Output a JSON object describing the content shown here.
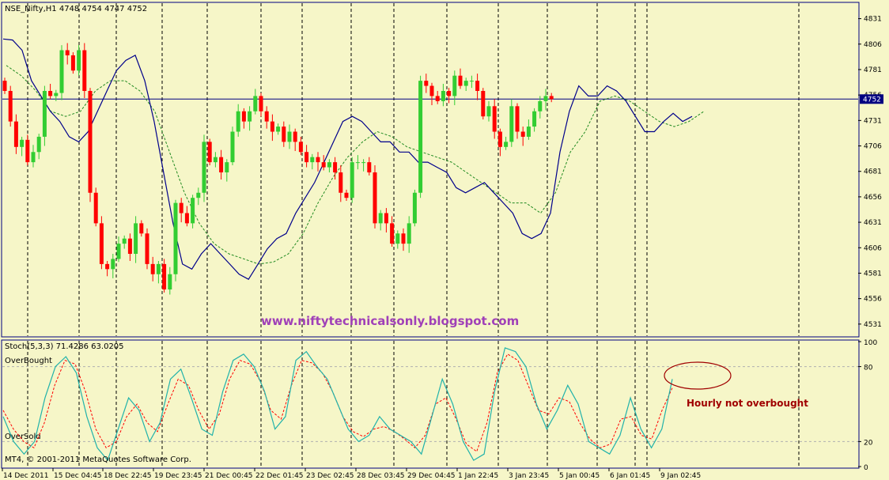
{
  "colors": {
    "background": "#f6f6c8",
    "frame": "#000080",
    "bull": "#32cd32",
    "bear": "#ff0000",
    "ma_fast": "#00008b",
    "ma_slow": "#228b22",
    "stoch_main": "#20b2aa",
    "stoch_signal": "#ff0000",
    "watermark": "#a040b8",
    "annotation": "#a00000",
    "current_price_box": "#000080"
  },
  "chart_data": [
    {
      "type": "candlestick",
      "title": "NSE_Nifty,H1  4748 4754 4747 4752",
      "ylim": [
        4520,
        4840
      ],
      "y_ticks": [
        "4831",
        "4806",
        "4781",
        "4756",
        "4731",
        "4706",
        "4681",
        "4656",
        "4631",
        "4606",
        "4581",
        "4556",
        "4531"
      ],
      "current_price": "4752",
      "x_labels": [
        "14 Dec 2011",
        "15 Dec 04:45",
        "18 Dec 22:45",
        "19 Dec 23:45",
        "21 Dec 00:45",
        "22 Dec 01:45",
        "23 Dec 02:45",
        "28 Dec 03:45",
        "29 Dec 04:45",
        "1 Jan 22:45",
        "3 Jan 23:45",
        "5 Jan 00:45",
        "6 Jan 01:45",
        "9 Jan 02:45"
      ],
      "watermark": "www.niftytechnicalsonly.blogspot.com",
      "candles_close": [
        4760,
        4730,
        4705,
        4712,
        4690,
        4700,
        4715,
        4760,
        4755,
        4758,
        4800,
        4795,
        4780,
        4800,
        4760,
        4660,
        4630,
        4590,
        4585,
        4595,
        4610,
        4615,
        4600,
        4630,
        4620,
        4590,
        4580,
        4590,
        4565,
        4580,
        4650,
        4640,
        4630,
        4655,
        4660,
        4710,
        4690,
        4695,
        4680,
        4690,
        4720,
        4740,
        4730,
        4740,
        4755,
        4740,
        4730,
        4720,
        4725,
        4710,
        4720,
        4710,
        4700,
        4690,
        4695,
        4690,
        4685,
        4690,
        4680,
        4660,
        4655,
        4690,
        4690,
        4690,
        4680,
        4630,
        4640,
        4630,
        4610,
        4620,
        4610,
        4630,
        4660,
        4770,
        4765,
        4755,
        4750,
        4760,
        4755,
        4775,
        4765,
        4770,
        4770,
        4760,
        4735,
        4745,
        4720,
        4705,
        4710,
        4745,
        4720,
        4715,
        4725,
        4740,
        4750,
        4755,
        4752
      ],
      "fast_ma": [
        4811,
        4810,
        4800,
        4770,
        4755,
        4740,
        4730,
        4715,
        4710,
        4720,
        4740,
        4760,
        4780,
        4790,
        4795,
        4770,
        4730,
        4680,
        4630,
        4590,
        4585,
        4600,
        4610,
        4600,
        4590,
        4580,
        4575,
        4590,
        4605,
        4615,
        4620,
        4640,
        4655,
        4670,
        4690,
        4710,
        4730,
        4735,
        4730,
        4720,
        4710,
        4710,
        4700,
        4700,
        4690,
        4690,
        4685,
        4680,
        4665,
        4660,
        4665,
        4670,
        4660,
        4650,
        4640,
        4620,
        4615,
        4620,
        4640,
        4700,
        4740,
        4765,
        4755,
        4755,
        4765,
        4760,
        4750,
        4735,
        4720,
        4720,
        4730,
        4738,
        4730,
        4735
      ],
      "slow_ma": [
        4785,
        4775,
        4760,
        4740,
        4735,
        4740,
        4760,
        4770,
        4770,
        4760,
        4740,
        4700,
        4660,
        4630,
        4610,
        4600,
        4595,
        4590,
        4592,
        4600,
        4620,
        4650,
        4675,
        4695,
        4710,
        4720,
        4715,
        4705,
        4700,
        4695,
        4690,
        4680,
        4670,
        4660,
        4650,
        4650,
        4640,
        4660,
        4700,
        4720,
        4750,
        4755,
        4750,
        4740,
        4730,
        4725,
        4730,
        4740
      ]
    },
    {
      "type": "line",
      "title": "Stoch(5,3,3) 71.4286 63.0205",
      "ylim": [
        0,
        100
      ],
      "y_ticks": [
        "100",
        "80",
        "20",
        "0"
      ],
      "levels": {
        "overbought": 80,
        "oversold": 20
      },
      "overbought_label": "OverBought",
      "oversold_label": "OverSold",
      "annotation": "Hourly not overbought",
      "main": [
        40,
        20,
        10,
        20,
        55,
        80,
        88,
        75,
        40,
        15,
        5,
        30,
        55,
        45,
        20,
        35,
        70,
        78,
        55,
        30,
        25,
        60,
        85,
        90,
        80,
        60,
        30,
        40,
        85,
        92,
        80,
        70,
        50,
        30,
        20,
        25,
        40,
        30,
        25,
        20,
        10,
        40,
        70,
        50,
        20,
        5,
        10,
        60,
        95,
        92,
        80,
        50,
        30,
        45,
        65,
        50,
        20,
        15,
        10,
        25,
        55,
        30,
        15,
        30,
        70
      ],
      "signal": [
        45,
        30,
        20,
        15,
        35,
        65,
        85,
        82,
        60,
        30,
        15,
        20,
        40,
        50,
        35,
        28,
        50,
        70,
        65,
        45,
        30,
        42,
        70,
        85,
        82,
        68,
        45,
        38,
        65,
        85,
        83,
        75,
        60,
        40,
        28,
        24,
        30,
        32,
        28,
        22,
        15,
        25,
        50,
        55,
        38,
        18,
        12,
        35,
        75,
        90,
        85,
        65,
        45,
        42,
        55,
        52,
        35,
        22,
        15,
        18,
        38,
        40,
        25,
        22,
        45,
        63
      ]
    }
  ],
  "footer": "MT4, © 2001-2011 MetaQuotes Software Corp."
}
